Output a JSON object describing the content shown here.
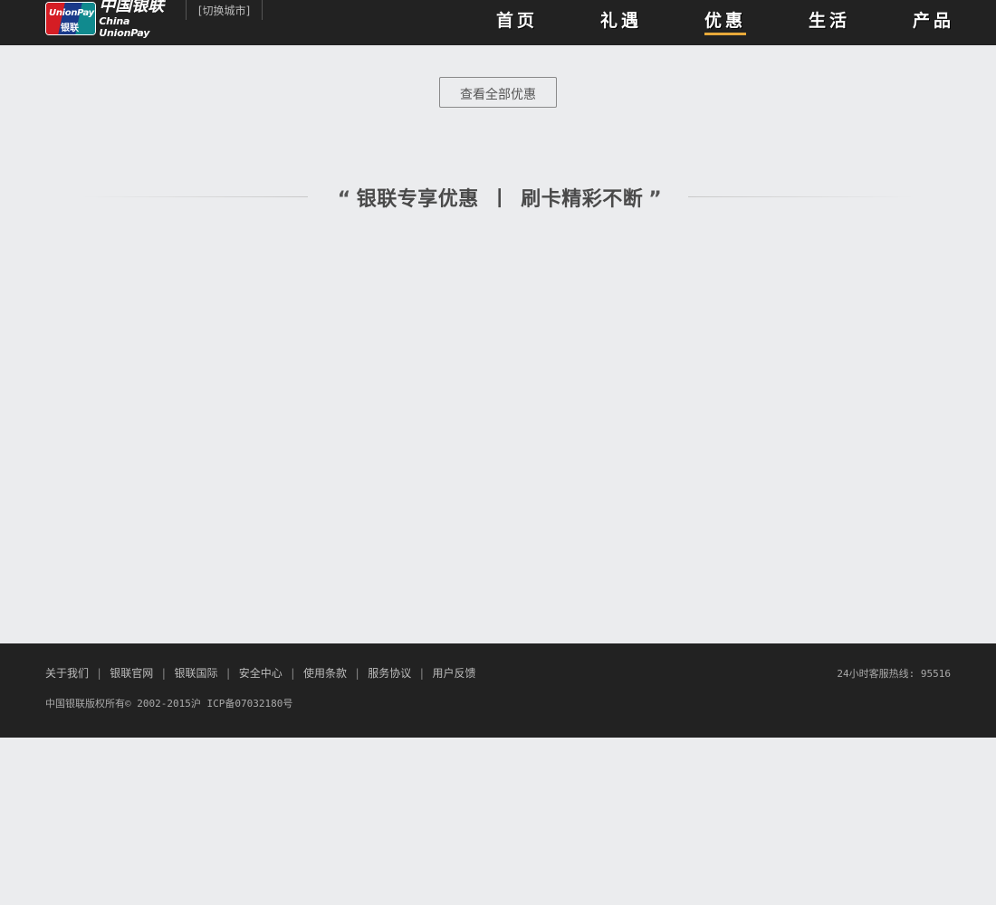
{
  "header": {
    "logo": {
      "card_text_en": "UnionPay",
      "card_text_cn": "银联",
      "name_cn": "中国银联",
      "name_en": "China UnionPay"
    },
    "city_switch": "[切换城市]",
    "nav": [
      {
        "label": "首页",
        "active": false
      },
      {
        "label": "礼遇",
        "active": false
      },
      {
        "label": "优惠",
        "active": true
      },
      {
        "label": "生活",
        "active": false
      },
      {
        "label": "产品",
        "active": false
      }
    ],
    "active_color": "#e8a93a"
  },
  "main": {
    "view_all_button": "查看全部优惠",
    "slogan": {
      "open_quote": "“",
      "part1": "银联专享优惠",
      "divider": "丨",
      "part2": "刷卡精彩不断",
      "close_quote": "”"
    }
  },
  "footer": {
    "links": [
      "关于我们",
      "银联官网",
      "银联国际",
      "安全中心",
      "使用条款",
      "服务协议",
      "用户反馈"
    ],
    "separator": "|",
    "copyright": "中国银联版权所有© 2002-2015沪 ICP备07032180号",
    "hotline": "24小时客服热线: 95516"
  }
}
